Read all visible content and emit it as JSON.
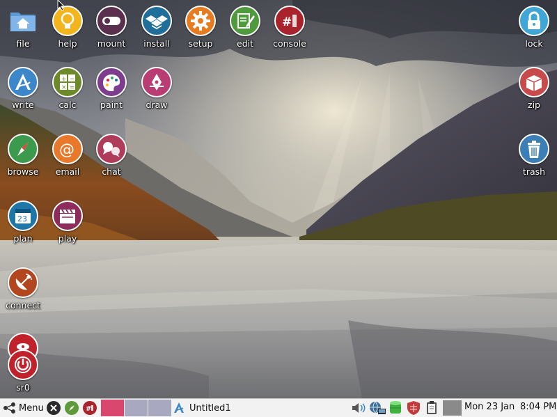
{
  "desktop": {
    "icons": [
      {
        "label": "file",
        "icon": "folder-home-icon"
      },
      {
        "label": "help",
        "icon": "lightbulb-icon"
      },
      {
        "label": "mount",
        "icon": "toggle-switch-icon"
      },
      {
        "label": "install",
        "icon": "dropbox-box-icon"
      },
      {
        "label": "setup",
        "icon": "gear-icon"
      },
      {
        "label": "edit",
        "icon": "pencil-notepad-icon"
      },
      {
        "label": "console",
        "icon": "terminal-hash-icon"
      },
      {
        "label": "lock",
        "icon": "padlock-icon"
      },
      {
        "label": "write",
        "icon": "writer-a-icon"
      },
      {
        "label": "calc",
        "icon": "calculator-icon"
      },
      {
        "label": "paint",
        "icon": "palette-icon"
      },
      {
        "label": "draw",
        "icon": "draw-pen-icon"
      },
      {
        "label": "zip",
        "icon": "package-box-icon"
      },
      {
        "label": "browse",
        "icon": "compass-icon"
      },
      {
        "label": "email",
        "icon": "at-sign-icon"
      },
      {
        "label": "chat",
        "icon": "chat-bubbles-icon"
      },
      {
        "label": "trash",
        "icon": "trash-can-icon"
      },
      {
        "label": "plan",
        "icon": "calendar-icon"
      },
      {
        "label": "play",
        "icon": "clapperboard-icon"
      },
      {
        "label": "connect",
        "icon": "satellite-dish-icon"
      },
      {
        "label": "sr0",
        "icon": "optical-drive-icon"
      }
    ]
  },
  "taskbar": {
    "menu_label": "Menu",
    "task_title": "Untitled1",
    "calendar_day": "23",
    "clock_date": "Mon 23 Jan",
    "clock_time": "8:04 PM"
  },
  "colors": {
    "help": "#f2b51d",
    "mount": "#5b2f4e",
    "install": "#1f6f9a",
    "setup": "#e67c22",
    "edit": "#4f9a3c",
    "console": "#a8232b",
    "lock": "#3fa6d6",
    "write": "#3c87c9",
    "calc": "#6d8a2b",
    "paint": "#7d3c8d",
    "draw": "#b93c73",
    "zip": "#c84b4b",
    "browse": "#3c9a4c",
    "email": "#e8782a",
    "chat": "#b03c5c",
    "trash": "#3c7fb7",
    "plan": "#1f77a8",
    "play": "#8d2c5a",
    "connect": "#b2471f",
    "sr0": "#c0222b",
    "workspace_active": "#d9466e",
    "workspace_inactive": "#a8a8c0"
  }
}
